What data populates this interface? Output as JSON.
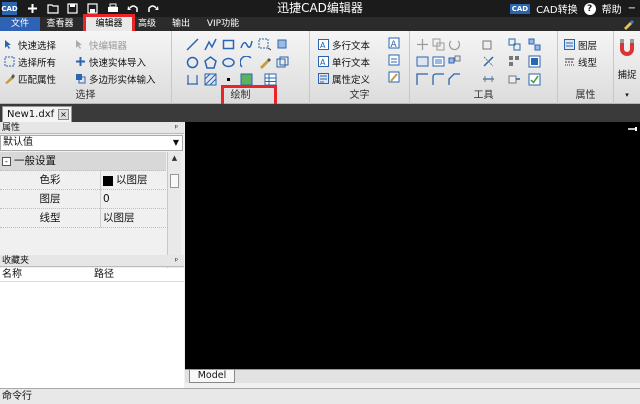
{
  "titlebar": {
    "title": "迅捷CAD编辑器",
    "logo_text": "CAD",
    "quick_access_icons": [
      "new-icon",
      "open-icon",
      "save-icon",
      "save-as-icon",
      "print-icon",
      "undo-icon",
      "redo-icon"
    ],
    "convert_badge": "CAD",
    "convert_label": "CAD转换",
    "help_label": "帮助"
  },
  "menu": {
    "file": "文件",
    "tabs": [
      "查看器",
      "编辑器",
      "高级",
      "输出",
      "VIP功能"
    ],
    "active_tab": "编辑器"
  },
  "ribbon": {
    "select_group": {
      "label": "选择",
      "quick_select": "快速选择",
      "select_all": "选择所有",
      "match_props": "匹配属性",
      "quick_editor": "快编辑器",
      "quick_entity_import": "快速实体导入",
      "polygon_entity_input": "多边形实体输入"
    },
    "draw_group": {
      "label": "绘制"
    },
    "text_group": {
      "label": "文字",
      "multiline_text": "多行文本",
      "single_line_text": "单行文本",
      "attribute_def": "属性定义"
    },
    "tools_group": {
      "label": "工具"
    },
    "props_group": {
      "label": "属性",
      "layer": "图层",
      "linetype": "线型"
    },
    "snap_group": {
      "label": "捕捉"
    }
  },
  "doc": {
    "tab_name": "New1.dxf",
    "close": "×"
  },
  "properties_panel": {
    "title": "属性",
    "pin": "ᵖ",
    "selector": "默认值",
    "category": "一般设置",
    "expander": "-",
    "rows": [
      {
        "key": "色彩",
        "value": "以图层"
      },
      {
        "key": "图层",
        "value": "0"
      },
      {
        "key": "线型",
        "value": "以图层"
      }
    ]
  },
  "favorites_panel": {
    "title": "收藏夹",
    "pin": "ᵖ",
    "col_name": "名称",
    "col_path": "路径"
  },
  "canvas": {
    "model_tab": "Model"
  },
  "command_line": {
    "label": "命令行"
  },
  "colors": {
    "title_bg": "#1b1b1b",
    "file_tab": "#2e62b5",
    "highlight": "#e8262a",
    "canvas_bg": "#000000"
  }
}
